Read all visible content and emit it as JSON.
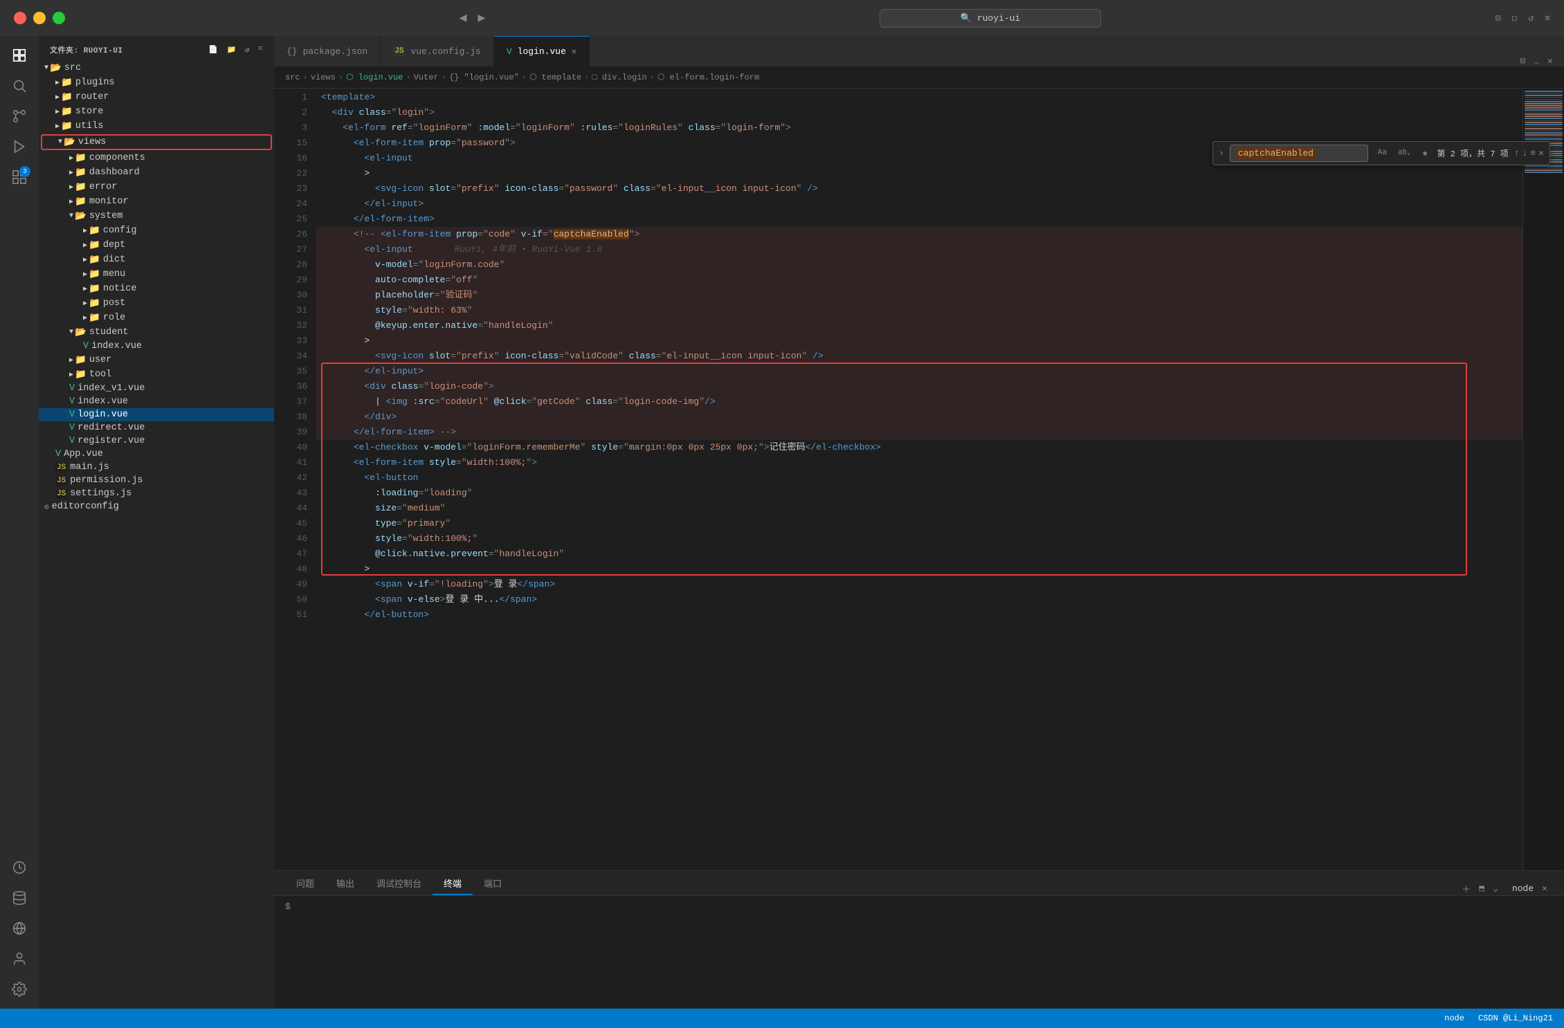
{
  "titleBar": {
    "searchText": "ruoyi-ui",
    "navBack": "◀",
    "navForward": "▶"
  },
  "sidebar": {
    "header": "文件夹: RUOYI-UI",
    "tree": [
      {
        "id": "src",
        "label": "src",
        "type": "folder",
        "open": true,
        "level": 0
      },
      {
        "id": "plugins",
        "label": "plugins",
        "type": "folder",
        "open": false,
        "level": 1
      },
      {
        "id": "router",
        "label": "router",
        "type": "folder",
        "open": false,
        "level": 1
      },
      {
        "id": "store",
        "label": "store",
        "type": "folder",
        "open": false,
        "level": 1
      },
      {
        "id": "utils",
        "label": "utils",
        "type": "folder",
        "open": false,
        "level": 1
      },
      {
        "id": "views",
        "label": "views",
        "type": "folder",
        "open": true,
        "level": 1,
        "highlighted": true
      },
      {
        "id": "components",
        "label": "components",
        "type": "folder",
        "open": false,
        "level": 2
      },
      {
        "id": "dashboard",
        "label": "dashboard",
        "type": "folder",
        "open": false,
        "level": 2
      },
      {
        "id": "error",
        "label": "error",
        "type": "folder",
        "open": false,
        "level": 2
      },
      {
        "id": "monitor",
        "label": "monitor",
        "type": "folder",
        "open": false,
        "level": 2
      },
      {
        "id": "system",
        "label": "system",
        "type": "folder",
        "open": true,
        "level": 2
      },
      {
        "id": "config",
        "label": "config",
        "type": "folder",
        "open": false,
        "level": 3
      },
      {
        "id": "dept",
        "label": "dept",
        "type": "folder",
        "open": false,
        "level": 3
      },
      {
        "id": "dict",
        "label": "dict",
        "type": "folder",
        "open": false,
        "level": 3
      },
      {
        "id": "menu",
        "label": "menu",
        "type": "folder",
        "open": false,
        "level": 3
      },
      {
        "id": "notice",
        "label": "notice",
        "type": "folder",
        "open": false,
        "level": 3
      },
      {
        "id": "post",
        "label": "post",
        "type": "folder",
        "open": false,
        "level": 3
      },
      {
        "id": "role",
        "label": "role",
        "type": "folder",
        "open": false,
        "level": 3
      },
      {
        "id": "student",
        "label": "student",
        "type": "folder",
        "open": true,
        "level": 2
      },
      {
        "id": "student-index",
        "label": "index.vue",
        "type": "vue",
        "level": 3
      },
      {
        "id": "user",
        "label": "user",
        "type": "folder",
        "open": false,
        "level": 2
      },
      {
        "id": "tool",
        "label": "tool",
        "type": "folder",
        "open": false,
        "level": 2
      },
      {
        "id": "index-v1",
        "label": "index_v1.vue",
        "type": "vue",
        "level": 2
      },
      {
        "id": "index-vue",
        "label": "index.vue",
        "type": "vue",
        "level": 2
      },
      {
        "id": "login-vue",
        "label": "login.vue",
        "type": "vue",
        "level": 2,
        "active": true
      },
      {
        "id": "redirect-vue",
        "label": "redirect.vue",
        "type": "vue",
        "level": 2
      },
      {
        "id": "register-vue",
        "label": "register.vue",
        "type": "vue",
        "level": 2
      },
      {
        "id": "app-vue",
        "label": "App.vue",
        "type": "vue",
        "level": 1
      },
      {
        "id": "main-js",
        "label": "main.js",
        "type": "js",
        "level": 1
      },
      {
        "id": "permission-js",
        "label": "permission.js",
        "type": "js",
        "level": 1
      },
      {
        "id": "settings-js",
        "label": "settings.js",
        "type": "js",
        "level": 1
      },
      {
        "id": "editorconfig",
        "label": "editorconfig",
        "type": "config",
        "level": 0
      }
    ]
  },
  "tabs": [
    {
      "id": "package-json",
      "label": "package.json",
      "type": "json",
      "active": false
    },
    {
      "id": "vue-config",
      "label": "vue.config.js",
      "type": "js",
      "active": false
    },
    {
      "id": "login-vue",
      "label": "login.vue",
      "type": "vue",
      "active": true
    }
  ],
  "breadcrumb": {
    "parts": [
      "src",
      ">",
      "views",
      ">",
      "⬡ login.vue",
      ">",
      "Vuter",
      ">",
      "{} \"login.vue\"",
      ">",
      "⬡ template",
      ">",
      "□ div.login",
      ">",
      "⬡ el-form.login-form"
    ]
  },
  "searchBar": {
    "query": "captchaEnabled",
    "count": "第 2 项，共 7 项",
    "options": [
      "Aa",
      "ab,",
      "✱"
    ]
  },
  "codeLines": [
    {
      "num": 1,
      "content": "<template>",
      "tokens": [
        {
          "t": "tag",
          "v": "<template>"
        }
      ]
    },
    {
      "num": 2,
      "content": "  <div class=\"login\">",
      "tokens": [
        {
          "t": "punct",
          "v": "  "
        },
        {
          "t": "tag",
          "v": "<div"
        },
        {
          "t": "normal",
          "v": " "
        },
        {
          "t": "attr",
          "v": "class"
        },
        {
          "t": "punct",
          "v": "=\""
        },
        {
          "t": "val",
          "v": "login"
        },
        {
          "t": "punct",
          "v": "\">"
        }
      ]
    },
    {
      "num": 3,
      "content": "    <el-form ref=\"loginForm\" :model=\"loginForm\" :rules=\"loginRules\" class=\"login-form\">",
      "tokens": []
    },
    {
      "num": 15,
      "content": "      <el-form-item prop=\"password\">",
      "tokens": []
    },
    {
      "num": 16,
      "content": "        <el-input",
      "tokens": []
    },
    {
      "num": 22,
      "content": "        >",
      "tokens": []
    },
    {
      "num": 23,
      "content": "          <svg-icon slot=\"prefix\" icon-class=\"password\" class=\"el-input__icon input-icon\" />",
      "tokens": []
    },
    {
      "num": 24,
      "content": "        </el-input>",
      "tokens": []
    },
    {
      "num": 25,
      "content": "      </el-form-item>",
      "tokens": []
    },
    {
      "num": 26,
      "content": "      <!-- <el-form-item prop=\"code\" v-if=\"captchaEnabled\">",
      "tokens": [],
      "highlight": true
    },
    {
      "num": 27,
      "content": "        <el-input",
      "tokens": [],
      "highlight": true,
      "ghost": "RuoYi, 4年前 • RuoYi-Vue 1.0"
    },
    {
      "num": 28,
      "content": "          v-model=\"loginForm.code\"",
      "tokens": [],
      "highlight": true
    },
    {
      "num": 29,
      "content": "          auto-complete=\"off\"",
      "tokens": [],
      "highlight": true
    },
    {
      "num": 30,
      "content": "          placeholder=\"验证码\"",
      "tokens": [],
      "highlight": true
    },
    {
      "num": 31,
      "content": "          style=\"width: 63%\"",
      "tokens": [],
      "highlight": true
    },
    {
      "num": 32,
      "content": "          @keyup.enter.native=\"handleLogin\"",
      "tokens": [],
      "highlight": true
    },
    {
      "num": 33,
      "content": "        >",
      "tokens": [],
      "highlight": true
    },
    {
      "num": 34,
      "content": "          <svg-icon slot=\"prefix\" icon-class=\"validCode\" class=\"el-input__icon input-icon\" />",
      "tokens": [],
      "highlight": true
    },
    {
      "num": 35,
      "content": "        </el-input>",
      "tokens": [],
      "highlight": true
    },
    {
      "num": 36,
      "content": "        <div class=\"login-code\">",
      "tokens": [],
      "highlight": true
    },
    {
      "num": 37,
      "content": "          | <img :src=\"codeUrl\" @click=\"getCode\" class=\"login-code-img\"/>",
      "tokens": [],
      "highlight": true
    },
    {
      "num": 38,
      "content": "        </div>",
      "tokens": [],
      "highlight": true
    },
    {
      "num": 39,
      "content": "      </el-form-item> -->",
      "tokens": [],
      "highlight": true
    },
    {
      "num": 40,
      "content": "      <el-checkbox v-model=\"loginForm.rememberMe\" style=\"margin:0px 0px 25px 0px;\">记住密码</el-checkbox>",
      "tokens": []
    },
    {
      "num": 41,
      "content": "      <el-form-item style=\"width:100%;\">",
      "tokens": []
    },
    {
      "num": 42,
      "content": "        <el-button",
      "tokens": []
    },
    {
      "num": 43,
      "content": "          :loading=\"loading\"",
      "tokens": []
    },
    {
      "num": 44,
      "content": "          size=\"medium\"",
      "tokens": []
    },
    {
      "num": 45,
      "content": "          type=\"primary\"",
      "tokens": []
    },
    {
      "num": 46,
      "content": "          style=\"width:100%;\"",
      "tokens": []
    },
    {
      "num": 47,
      "content": "          @click.native.prevent=\"handleLogin\"",
      "tokens": []
    },
    {
      "num": 48,
      "content": "        >",
      "tokens": []
    },
    {
      "num": 49,
      "content": "          <span v-if=\"!loading\">登 录</span>",
      "tokens": []
    },
    {
      "num": 50,
      "content": "          <span v-else>登 录 中...</span>",
      "tokens": []
    },
    {
      "num": 51,
      "content": "        </el-button>",
      "tokens": []
    }
  ],
  "panelTabs": [
    "问题",
    "输出",
    "调试控制台",
    "终端",
    "端口"
  ],
  "activePanelTab": "终端",
  "statusBar": {
    "left": "",
    "right": [
      "node",
      "CSDN @Li_Ning21"
    ]
  }
}
